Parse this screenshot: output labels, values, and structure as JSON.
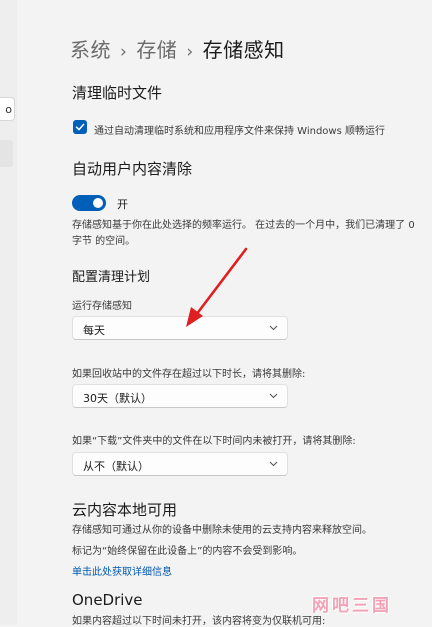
{
  "breadcrumb": {
    "level1": "系统",
    "level2": "存储",
    "current": "存储感知",
    "separator": "›"
  },
  "left_pane": {
    "search_glyph": "o"
  },
  "cleanup_temp": {
    "title": "清理临时文件",
    "checkbox_label": "通过自动清理临时系统和应用程序文件来保持 Windows 顺畅运行",
    "checked": true
  },
  "auto_cleanup": {
    "title": "自动用户内容清除",
    "toggle_label": "开",
    "toggle_on": true,
    "description": "存储感知基于你在此处选择的频率运行。 在过去的一个月中，我们已清理了 0 字节 的空间。"
  },
  "schedule": {
    "title": "配置清理计划",
    "run_label": "运行存储感知",
    "run_value": "每天",
    "recycle_label": "如果回收站中的文件存在超过以下时长，请将其删除:",
    "recycle_value": "30天（默认）",
    "downloads_label": "如果“下载”文件夹中的文件在以下时间内未被打开，请将其删除:",
    "downloads_value": "从不（默认）"
  },
  "cloud": {
    "title": "云内容本地可用",
    "line1": "存储感知可通过从你的设备中删除未使用的云支持内容来释放空间。",
    "line2": "标记为“始终保留在此设备上”的内容不会受到影响。",
    "link": "单击此处获取详细信息"
  },
  "onedrive": {
    "title": "OneDrive",
    "description": "如果内容超过以下时间未打开，该内容将变为仅联机可用:"
  },
  "watermark": "网吧三国",
  "colors": {
    "accent": "#005fb8",
    "link": "#0058b0",
    "annotation_arrow": "#e02020",
    "watermark": "#f2a3b8"
  }
}
